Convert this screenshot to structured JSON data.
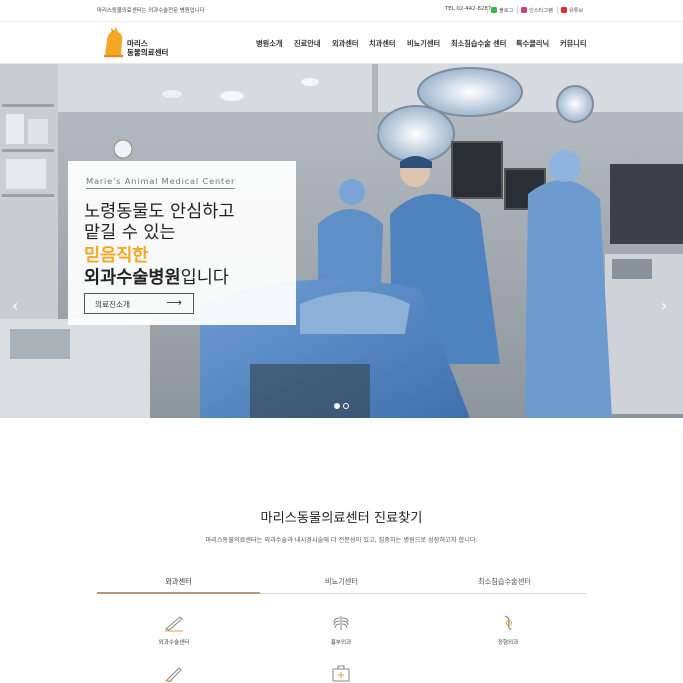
{
  "topbar": {
    "notice": "마리스동물의료센터는 외과수술전문 병원입니다",
    "tel": "TEL 02-442-8287",
    "sns": [
      {
        "icon": "blog-icon",
        "label": "블로그",
        "color": "#3fb24a"
      },
      {
        "icon": "instagram-icon",
        "label": "인스타그램",
        "color": "#d63d85"
      },
      {
        "icon": "youtube-icon",
        "label": "유튜브",
        "color": "#e42b2b"
      }
    ]
  },
  "header": {
    "logo_line1": "마리스",
    "logo_line2": "동물의료센터",
    "nav": [
      "병원소개",
      "진료안내",
      "외과센터",
      "치과센터",
      "비뇨기센터",
      "최소침습수술 센터",
      "특수클리닉",
      "커뮤니티"
    ]
  },
  "hero": {
    "subtitle": "Marie's  Animal  Medical  Center",
    "line1": "노령동물도 안심하고",
    "line2": "맡길 수 있는",
    "line3": "믿음직한",
    "line4_bold": "외과수술병원",
    "line4_rest": "입니다",
    "button_label": "의료진소개",
    "button_arrow": "⟶",
    "prev": "‹",
    "next": "›",
    "slides": 2,
    "active_slide": 1
  },
  "finder": {
    "title": "마리스동물의료센터 진료찾기",
    "description": "마리스동물의료센터는 외과수술과 내시경시술에 더 전문성이 있고, 집중하는 병원으로 성장하고자 합니다.",
    "tabs": [
      "외과센터",
      "비뇨기센터",
      "최소침습수술센터"
    ],
    "active_tab": 0,
    "items": [
      {
        "icon": "scalpel-icon",
        "label": "외과수술센터"
      },
      {
        "icon": "ribcage-icon",
        "label": "흉부외과"
      },
      {
        "icon": "joint-icon",
        "label": "정형외과"
      },
      {
        "icon": "pen-icon",
        "label": ""
      },
      {
        "icon": "medical-kit-icon",
        "label": ""
      }
    ]
  },
  "colors": {
    "accent": "#f5a623",
    "tab_underline": "#b89a79",
    "scrub": "#4f83c0"
  }
}
